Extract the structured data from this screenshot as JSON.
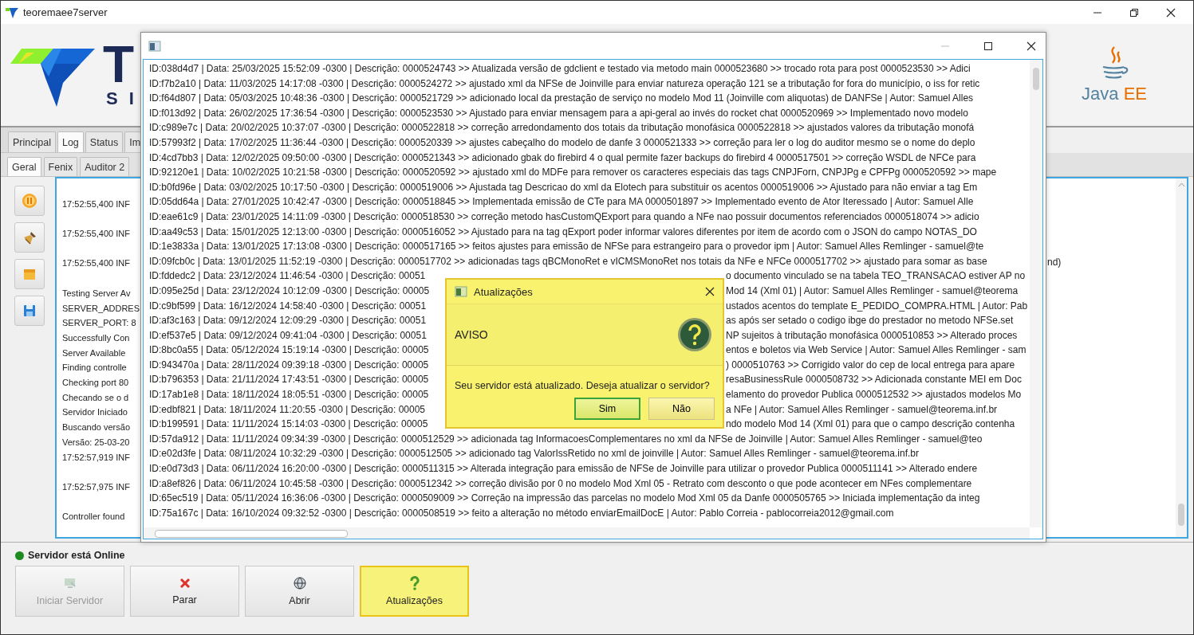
{
  "window": {
    "title": "teoremaee7server"
  },
  "header": {
    "brand_letter": "T",
    "brand_subletters": "S I",
    "java_word": "Java",
    "java_suffix": "EE"
  },
  "tabs": [
    {
      "label": "Principal",
      "selected": false
    },
    {
      "label": "Log",
      "selected": true
    },
    {
      "label": "Status",
      "selected": false
    },
    {
      "label": "Im",
      "selected": false
    }
  ],
  "subtabs": [
    {
      "label": "Geral",
      "selected": true
    },
    {
      "label": "Fenix",
      "selected": false
    },
    {
      "label": "Auditor 2",
      "selected": false
    }
  ],
  "console": {
    "lines": [
      {
        "text": "17:52:55,400 INF",
        "spaced": true
      },
      {
        "text": "17:52:55,400 INF",
        "spaced": true
      },
      {
        "text": "17:52:55,400 INF",
        "spaced": true
      },
      {
        "text": "Testing Server Av",
        "spaced": true
      },
      {
        "text": "SERVER_ADDRES",
        "spaced": false
      },
      {
        "text": "SERVER_PORT: 8",
        "spaced": false
      },
      {
        "text": "Successfully Con",
        "spaced": false
      },
      {
        "text": "Server Available",
        "spaced": false
      },
      {
        "text": "Finding controlle",
        "spaced": false
      },
      {
        "text": "Checking port 80",
        "spaced": false
      },
      {
        "text": "Checando se o d",
        "spaced": false
      },
      {
        "text": "Servidor Iniciado",
        "spaced": false
      },
      {
        "text": "Buscando versão",
        "spaced": false
      },
      {
        "text": "Versão: 25-03-20",
        "spaced": false
      },
      {
        "text": "17:52:57,919 INF",
        "spaced": false
      },
      {
        "text": "17:52:57,975 INF",
        "spaced": true
      },
      {
        "text": "Controller found",
        "spaced": true
      }
    ],
    "right_fragment": "nd)"
  },
  "status": {
    "text": "Servidor está Online",
    "online": true
  },
  "buttons": [
    {
      "label": "Iniciar Servidor",
      "kind": "start",
      "disabled": true,
      "highlighted": false
    },
    {
      "label": "Parar",
      "kind": "stop",
      "disabled": false,
      "highlighted": false
    },
    {
      "label": "Abrir",
      "kind": "open",
      "disabled": false,
      "highlighted": false
    },
    {
      "label": "Atualizações",
      "kind": "update",
      "disabled": false,
      "highlighted": true
    }
  ],
  "log_window": {
    "lines": [
      {
        "text": "ID:038d4d7 | Data: 25/03/2025 15:52:09 -0300 | Descrição: 0000524743 >> Atualizada versão de gdclient e testado via metodo main 0000523680 >> trocado rota para post 0000523530 >> Adici"
      },
      {
        "text": "ID:f7b2a10 | Data: 11/03/2025 14:17:08 -0300 | Descrição: 0000524272 >> ajustado xml da NFSe de Joinville para enviar natureza operação 121 se a tributação for fora do município, o iss for retic"
      },
      {
        "text": "ID:f64d807 | Data: 05/03/2025 10:48:36 -0300 | Descrição: 0000521729 >> adicionado local da prestação de serviço no modelo Mod 11 (Joinville com aliquotas) de DANFSe | Autor: Samuel Alles"
      },
      {
        "text": "ID:f013d92 | Data: 26/02/2025 17:36:54 -0300 | Descrição: 0000523530 >> Ajustado para enviar mensagem para a api-geral ao invés do rocket chat 0000520969 >> Implementado novo modelo"
      },
      {
        "text": "ID:c989e7c | Data: 20/02/2025 10:37:07 -0300 | Descrição: 0000522818 >> correção arredondamento dos totais da tributação monofásica 0000522818 >> ajustados valores da tributação monofá"
      },
      {
        "text": "ID:57993f2 | Data: 17/02/2025 11:36:44 -0300 | Descrição: 0000520339 >> ajustes cabeçalho do modelo de danfe 3 0000521333 >> correção para ler o log do auditor mesmo se o nome do deplo"
      },
      {
        "text": "ID:4cd7bb3 | Data: 12/02/2025 09:50:00 -0300 | Descrição: 0000521343 >> adicionado gbak do firebird 4 o qual permite fazer backups do firebird 4 0000517501 >> correção WSDL de NFCe para"
      },
      {
        "text": "ID:92120e1 | Data: 10/02/2025 10:21:58 -0300 | Descrição: 0000520592 >> ajustado xml do MDFe para remover os caracteres especiais das tags CNPJForn, CNPJPg e CPFPg 0000520592 >> mape"
      },
      {
        "text": "ID:b0fd96e | Data: 03/02/2025 10:17:50 -0300 | Descrição: 0000519006 >> Ajustada tag Descricao do xml da Elotech para substituir os acentos 0000519006 >> Ajustado para não enviar a tag Em"
      },
      {
        "text": "ID:05dd64a | Data: 27/01/2025 10:42:47 -0300 | Descrição: 0000518845 >> Implementada emissão de CTe para MA 0000501897 >> Implementado evento de Ator Iteressado | Autor: Samuel Alle"
      },
      {
        "text": "ID:eae61c9 | Data: 23/01/2025 14:11:09 -0300 | Descrição: 0000518530 >> correção metodo hasCustomQExport para quando a NFe nao possuir documentos referenciados 0000518074 >> adicio"
      },
      {
        "text": "ID:aa49c53 | Data: 15/01/2025 12:13:00 -0300 | Descrição: 0000516052 >> Ajustado para na tag qExport poder informar valores diferentes por item de acordo com o JSON do campo NOTAS_DO"
      },
      {
        "text": "ID:1e3833a | Data: 13/01/2025 17:13:08 -0300 | Descrição: 0000517165 >> feitos ajustes para emissão de NFSe para estrangeiro para o provedor ipm | Autor: Samuel Alles Remlinger - samuel@te"
      },
      {
        "text": "ID:09fcb0c | Data: 13/01/2025 11:52:19 -0300 | Descrição: 0000517702 >> adicionadas tags qBCMonoRet e vICMSMonoRet nos totais da NFe e NFCe 0000517702 >> ajustado para somar as base"
      },
      {
        "left": "ID:fddedc2 | Data: 23/12/2024 11:46:54 -0300 | Descrição: 00051",
        "right": "o documento vinculado se na tabela TEO_TRANSACAO estiver AP no"
      },
      {
        "left": "ID:095e25d | Data: 23/12/2024 10:12:09 -0300 | Descrição: 00005",
        "right": "Mod 14 (Xml 01) | Autor: Samuel Alles Remlinger - samuel@teorema"
      },
      {
        "left": "ID:c9bf599 | Data: 16/12/2024 14:58:40 -0300 | Descrição: 00051",
        "right": "ustados acentos do template E_PEDIDO_COMPRA.HTML | Autor: Pab"
      },
      {
        "left": "ID:af3c163 | Data: 09/12/2024 12:09:29 -0300 | Descrição: 00051",
        "right": "as após ser setado o codigo ibge do prestador no metodo NFSe.set"
      },
      {
        "left": "ID:ef537e5 | Data: 09/12/2024 09:41:04 -0300 | Descrição: 00051",
        "right": "NP sujeitos à tributação monofásica 0000510853 >> Alterado proces"
      },
      {
        "left": "ID:8bc0a55 | Data: 05/12/2024 15:19:14 -0300 | Descrição: 00005",
        "right": "entos e boletos via Web Service | Autor: Samuel Alles Remlinger - sam"
      },
      {
        "left": "ID:943470a | Data: 28/11/2024 09:39:18 -0300 | Descrição: 00005",
        "right": ") 0000510763 >> Corrigido valor do cep de local entrega para apare"
      },
      {
        "left": "ID:b796353 | Data: 21/11/2024 17:43:51 -0300 | Descrição: 00005",
        "right": "resaBusinessRule 0000508732 >> Adicionada constante MEI em Doc"
      },
      {
        "left": "ID:17ab1e8 | Data: 18/11/2024 18:05:51 -0300 | Descrição: 00005",
        "right": "elamento do provedor Publica 0000512532 >> ajustados modelos Mo"
      },
      {
        "left": "ID:edbf821 | Data: 18/11/2024 11:20:55 -0300 | Descrição: 00005",
        "right": "a NFe | Autor: Samuel Alles Remlinger - samuel@teorema.inf.br"
      },
      {
        "left": "ID:b199591 | Data: 11/11/2024 15:14:03 -0300 | Descrição: 00005",
        "right": "ndo modelo Mod 14 (Xml 01) para que o campo descrição contenha"
      },
      {
        "text": "ID:57da912 | Data: 11/11/2024 09:34:39 -0300 | Descrição: 0000512529 >> adicionada tag InformacoesComplementares no xml da NFSe de Joinville | Autor: Samuel Alles Remlinger - samuel@teo"
      },
      {
        "text": "ID:e02d3fe | Data: 08/11/2024 10:32:29 -0300 | Descrição: 0000512505 >> adicionado tag ValorIssRetido no xml de joinville | Autor: Samuel Alles Remlinger - samuel@teorema.inf.br"
      },
      {
        "text": "ID:e0d73d3 | Data: 06/11/2024 16:20:00 -0300 | Descrição: 0000511315 >> Alterada integração para emissão de NFSe de Joinville para utilizar o provedor Publica 0000511141 >> Alterado endere"
      },
      {
        "text": "ID:a8ef826 | Data: 06/11/2024 10:45:58 -0300 | Descrição: 0000512342 >> correção divisão por 0 no modelo Mod Xml 05 - Retrato com desconto o que pode acontecer em NFes complementare"
      },
      {
        "text": "ID:65ec519 | Data: 05/11/2024 16:36:06 -0300 | Descrição: 0000509009 >> Correção na impressão das parcelas no modelo Mod Xml 05 da Danfe 0000505765 >> Iniciada implementação da integ"
      },
      {
        "text": "ID:75a167c | Data: 16/10/2024 09:32:52 -0300 | Descrição: 0000508519 >> feito a alteração no método enviarEmailDocE | Autor: Pablo Correia - pablocorreia2012@gmail.com"
      }
    ]
  },
  "dialog": {
    "title": "Atualizações",
    "heading": "AVISO",
    "message": "Seu servidor está atualizado. Deseja atualizar o servidor?",
    "buttons": [
      {
        "label": "Sim",
        "selected": true
      },
      {
        "label": "Não",
        "selected": false
      }
    ]
  }
}
